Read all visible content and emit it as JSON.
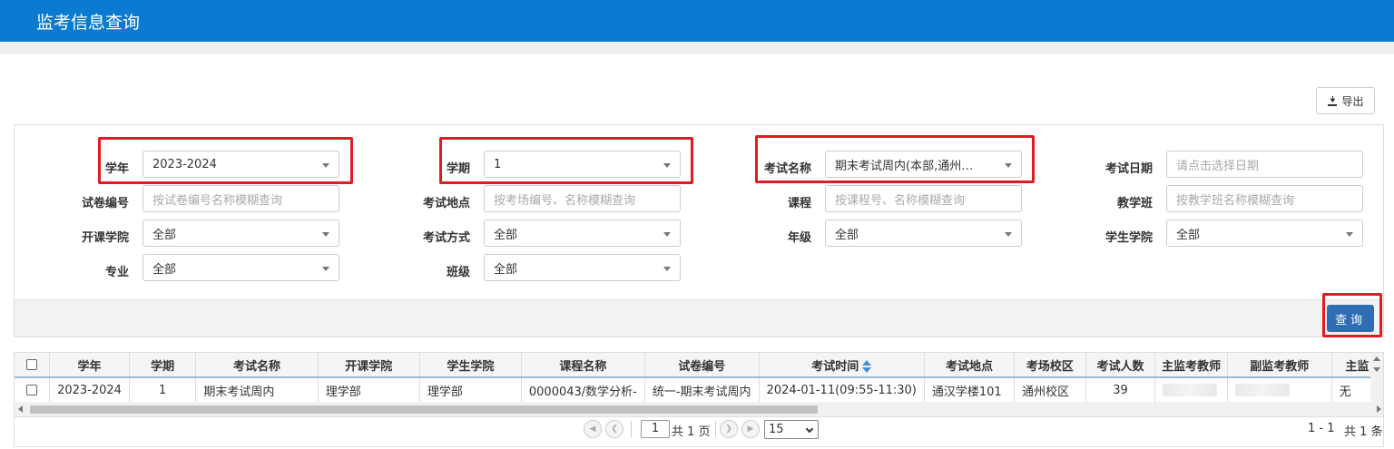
{
  "header": {
    "title": "监考信息查询"
  },
  "toolbar": {
    "export_label": "导出",
    "query_label": "查询"
  },
  "filters": {
    "academic_year": {
      "label": "学年",
      "value": "2023-2024"
    },
    "term": {
      "label": "学期",
      "value": "1"
    },
    "exam_name": {
      "label": "考试名称",
      "value": "期末考试周内(本部,通州…"
    },
    "exam_date": {
      "label": "考试日期",
      "placeholder": "请点击选择日期"
    },
    "paper_no": {
      "label": "试卷编号",
      "placeholder": "按试卷编号名称模糊查询"
    },
    "exam_location": {
      "label": "考试地点",
      "placeholder": "按考场编号、名称模糊查询"
    },
    "course": {
      "label": "课程",
      "placeholder": "按课程号、名称模糊查询"
    },
    "teaching_class": {
      "label": "教学班",
      "placeholder": "按教学班名称模糊查询"
    },
    "offering_college": {
      "label": "开课学院",
      "value": "全部"
    },
    "exam_method": {
      "label": "考试方式",
      "value": "全部"
    },
    "grade": {
      "label": "年级",
      "value": "全部"
    },
    "student_college": {
      "label": "学生学院",
      "value": "全部"
    },
    "major": {
      "label": "专业",
      "value": "全部"
    },
    "class": {
      "label": "班级",
      "value": "全部"
    }
  },
  "table": {
    "headers": [
      "学年",
      "学期",
      "考试名称",
      "开课学院",
      "学生学院",
      "课程名称",
      "试卷编号",
      "考试时间",
      "考试地点",
      "考场校区",
      "考试人数",
      "主监考教师",
      "副监考教师",
      "主监"
    ],
    "rows": [
      {
        "year": "2023-2024",
        "term": "1",
        "exam_name": "期末考试周内",
        "offering_college": "理学部",
        "student_college": "理学部",
        "course": "0000043/数学分析-",
        "paper": "统一-期末考试周内",
        "time": "2024-01-11(09:55-11:30)",
        "location": "通汉学楼101",
        "campus": "通州校区",
        "count": "39",
        "last": "无"
      }
    ]
  },
  "pager": {
    "current_page": "1",
    "total_pages_text": "共 1 页",
    "page_size": "15",
    "range_text": "1 - 1",
    "total_text": "共 1 条"
  }
}
